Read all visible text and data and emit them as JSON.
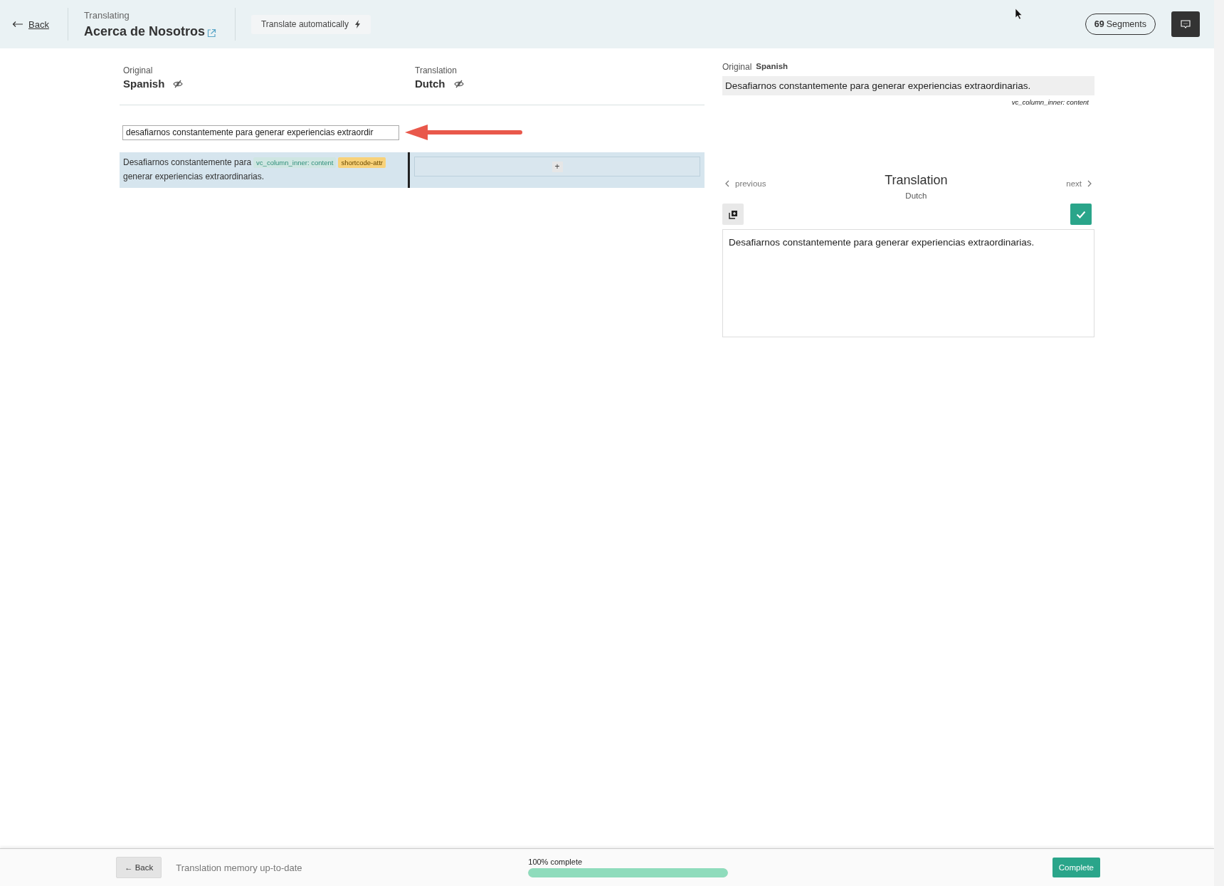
{
  "header": {
    "back": "Back",
    "eyebrow": "Translating",
    "title": "Acerca de Nosotros",
    "auto_button": "Translate automatically",
    "segments_count": "69",
    "segments_label": "Segments"
  },
  "columns": [
    {
      "caption": "Original",
      "language": "Spanish"
    },
    {
      "caption": "Translation",
      "language": "Dutch"
    }
  ],
  "search": {
    "value": "desafiarnos constantemente para generar experiencias extraordir"
  },
  "segments": [
    {
      "source_start": "Desafiarnos constantemente para",
      "source_end": "generar experiencias extraordinarias.",
      "tags": [
        {
          "label": "vc_column_inner: content",
          "color": "#cfe6e2"
        },
        {
          "label": "shortcode-attr",
          "color": "#f8d27a"
        }
      ],
      "selected": true,
      "add": "+"
    }
  ],
  "detail": {
    "original_caption": "Original",
    "original_language": "Spanish",
    "original_text": "Desafiarnos constantemente para generar experiencias extraordinarias.",
    "context": "vc_column_inner: content",
    "heading": "Translation",
    "language": "Dutch",
    "previous": "previous",
    "next": "next",
    "translation_text": "Desafiarnos constantemente para generar experiencias extraordinarias."
  },
  "footer": {
    "back": "← Back",
    "status": "Translation memory up-to-date",
    "progress_label": "100% complete",
    "level": 1.0,
    "complete": "Complete"
  }
}
